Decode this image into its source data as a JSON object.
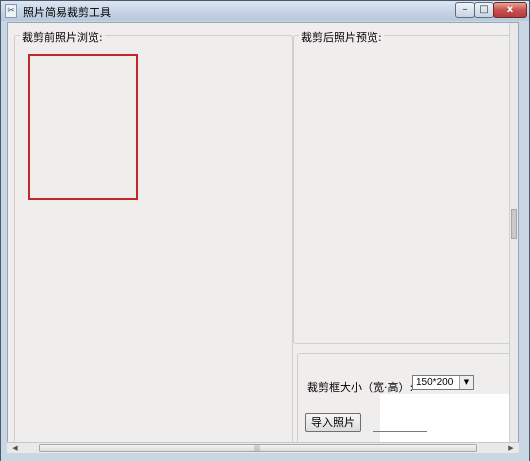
{
  "window": {
    "title": "照片简易裁剪工具",
    "app_icon": "app-icon",
    "controls": {
      "minimize": "–",
      "maximize": "□",
      "close": "x"
    }
  },
  "before_group": {
    "label": "裁剪前照片浏览:"
  },
  "after_group": {
    "label": "裁剪后照片预览:"
  },
  "crop_size": {
    "label": "裁剪框大小（宽·高）:",
    "selected": "150*200",
    "dropdown_icon": "▼"
  },
  "import_button": {
    "label": "导入照片"
  },
  "scrollbars": {
    "left_arrow": "◀",
    "right_arrow": "▶",
    "grip": "|||"
  },
  "colors": {
    "crop_frame": "#c0282c",
    "client_bg": "#f0eded"
  }
}
